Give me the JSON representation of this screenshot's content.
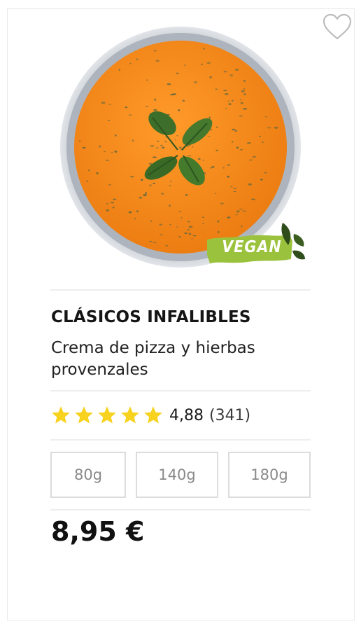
{
  "product": {
    "category": "CLÁSICOS INFALIBLES",
    "name": "Crema de pizza y hierbas provenzales",
    "badge": "VEGAN",
    "price": "8,95 €"
  },
  "rating": {
    "stars": 5,
    "value": "4,88",
    "count": "(341)"
  },
  "sizes": [
    {
      "label": "80g"
    },
    {
      "label": "140g"
    },
    {
      "label": "180g"
    }
  ],
  "icons": {
    "favorite": "heart-outline-icon",
    "star": "star-icon"
  },
  "colors": {
    "star": "#F7D21E",
    "badge": "#9BC23C",
    "soup": "#F28A1E",
    "bowl": "#C7CCD3",
    "border": "#DCDCDC"
  }
}
